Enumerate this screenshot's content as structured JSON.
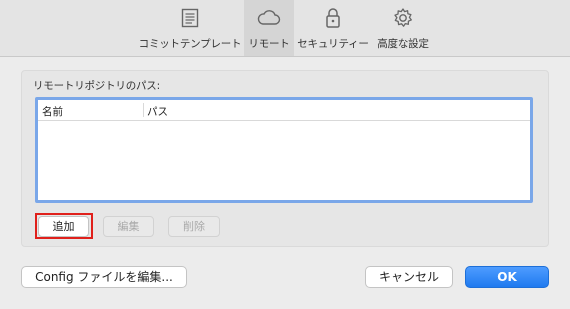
{
  "toolbar": {
    "tabs": [
      {
        "label": "コミットテンプレート",
        "icon": "document-icon"
      },
      {
        "label": "リモート",
        "icon": "cloud-icon"
      },
      {
        "label": "セキュリティー",
        "icon": "lock-icon"
      },
      {
        "label": "高度な設定",
        "icon": "gear-icon"
      }
    ],
    "active_tab": "リモート"
  },
  "remote": {
    "section_label": "リモートリポジトリのパス:",
    "table": {
      "columns": [
        "名前",
        "パス"
      ],
      "rows": []
    },
    "buttons": {
      "add": "追加",
      "edit": "編集",
      "delete": "削除"
    }
  },
  "footer": {
    "config_button": "Config ファイルを編集...",
    "cancel_button": "キャンセル",
    "ok_button": "OK"
  },
  "colors": {
    "accent": "#1f7aef",
    "highlight": "#e0201b",
    "focus_ring": "#7aa7e9"
  }
}
